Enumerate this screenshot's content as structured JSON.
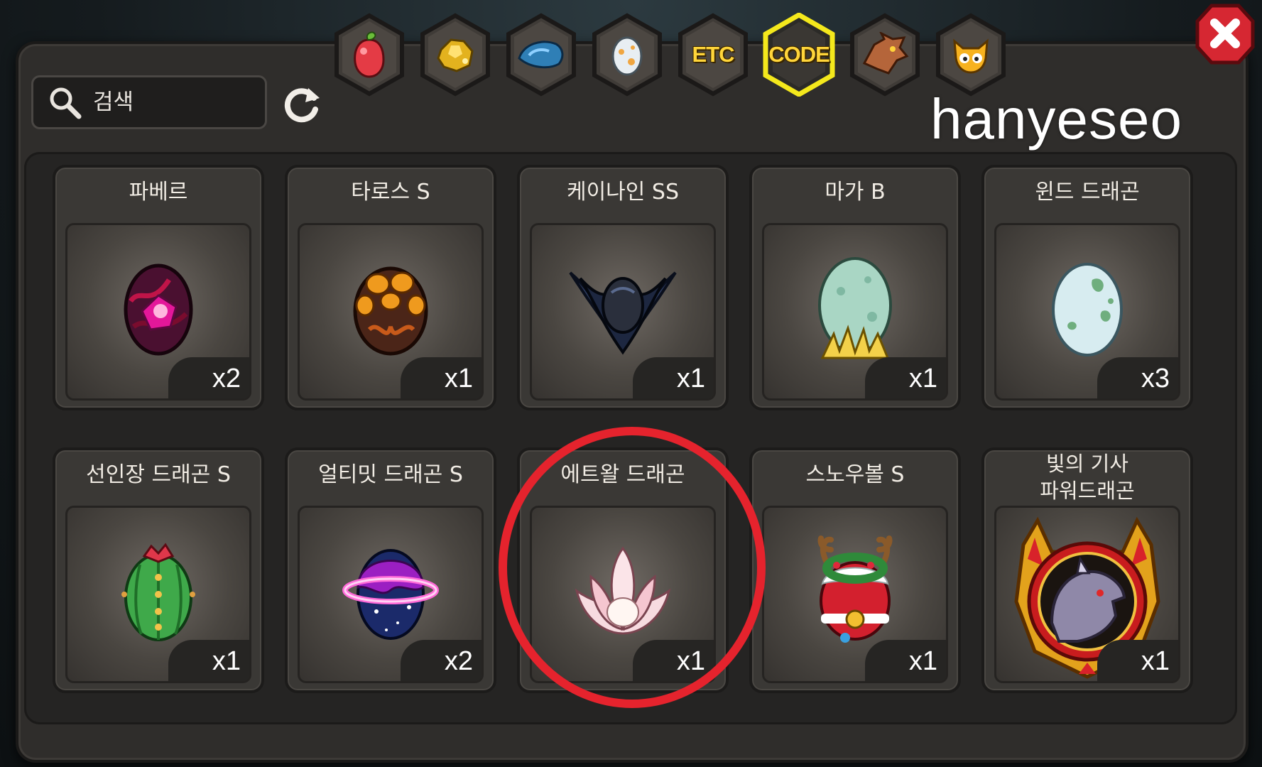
{
  "tabs": [
    {
      "name": "fruit",
      "icon": "fruit-icon",
      "label": ""
    },
    {
      "name": "gold",
      "icon": "gold-ore-icon",
      "label": ""
    },
    {
      "name": "scale",
      "icon": "dragon-scale-icon",
      "label": ""
    },
    {
      "name": "egg",
      "icon": "egg-icon",
      "label": ""
    },
    {
      "name": "etc",
      "icon": "",
      "label": "ETC"
    },
    {
      "name": "code",
      "icon": "",
      "label": "CODE",
      "selected": true
    },
    {
      "name": "dragon",
      "icon": "dragon-head-icon",
      "label": ""
    },
    {
      "name": "mascot",
      "icon": "mascot-icon",
      "label": ""
    }
  ],
  "search": {
    "placeholder": "검색"
  },
  "watermark": "hanyeseo",
  "items": [
    {
      "name": "파베르",
      "qty": "x2",
      "icon": "dark-pink-egg"
    },
    {
      "name": "타로스 S",
      "qty": "x1",
      "icon": "orange-spotted-egg"
    },
    {
      "name": "케이나인 SS",
      "qty": "x1",
      "icon": "dark-winged-egg"
    },
    {
      "name": "마가 B",
      "qty": "x1",
      "icon": "mint-egg-with-grass"
    },
    {
      "name": "윈드 드래곤",
      "qty": "x3",
      "icon": "pale-green-spotted-egg"
    },
    {
      "name": "선인장 드래곤 S",
      "qty": "x1",
      "icon": "cactus-egg"
    },
    {
      "name": "얼티밋 드래곤 S",
      "qty": "x2",
      "icon": "planet-ring-egg"
    },
    {
      "name": "에트왈 드래곤",
      "qty": "x1",
      "icon": "lotus-egg",
      "highlighted": true
    },
    {
      "name": "스노우볼 S",
      "qty": "x1",
      "icon": "snowball-reindeer-egg"
    },
    {
      "name_line1": "빛의 기사",
      "name_line2": "파워드래곤",
      "qty": "x1",
      "icon": "light-knight-dragon-emblem"
    }
  ],
  "colors": {
    "selected_tab_glow": "#f4e81c",
    "close_button": "#d62732",
    "highlight_circle": "#e5232d",
    "tab_label": "#ffd53a"
  }
}
